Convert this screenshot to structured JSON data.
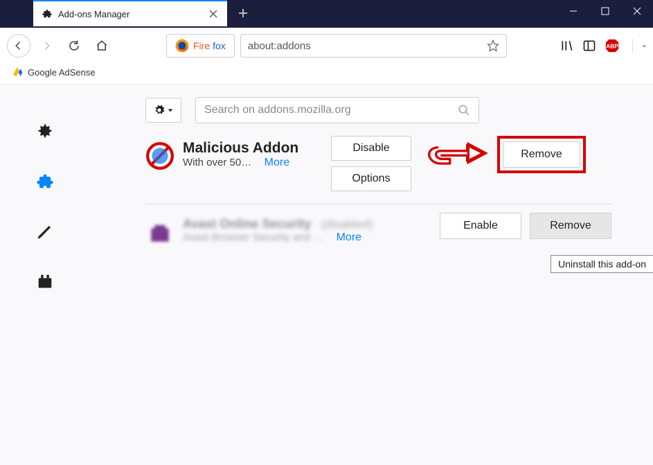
{
  "window": {
    "tab_title": "Add-ons Manager"
  },
  "identity": {
    "brand_a": "Fire",
    "brand_b": "fox"
  },
  "urlbar": {
    "value": "about:addons"
  },
  "bookmarks": {
    "item1": "Google AdSense"
  },
  "search": {
    "placeholder": "Search on addons.mozilla.org"
  },
  "addons": [
    {
      "name": "Malicious Addon",
      "desc": "With over 50…",
      "more": "More",
      "disable_label": "Disable",
      "options_label": "Options",
      "remove_label": "Remove"
    },
    {
      "name": "Avast Online Security",
      "disabled_tag": "(disabled)",
      "desc": "Avast Browser Security and …",
      "more": "More",
      "enable_label": "Enable",
      "remove_label": "Remove"
    }
  ],
  "tooltip": {
    "text": "Uninstall this add-on"
  }
}
